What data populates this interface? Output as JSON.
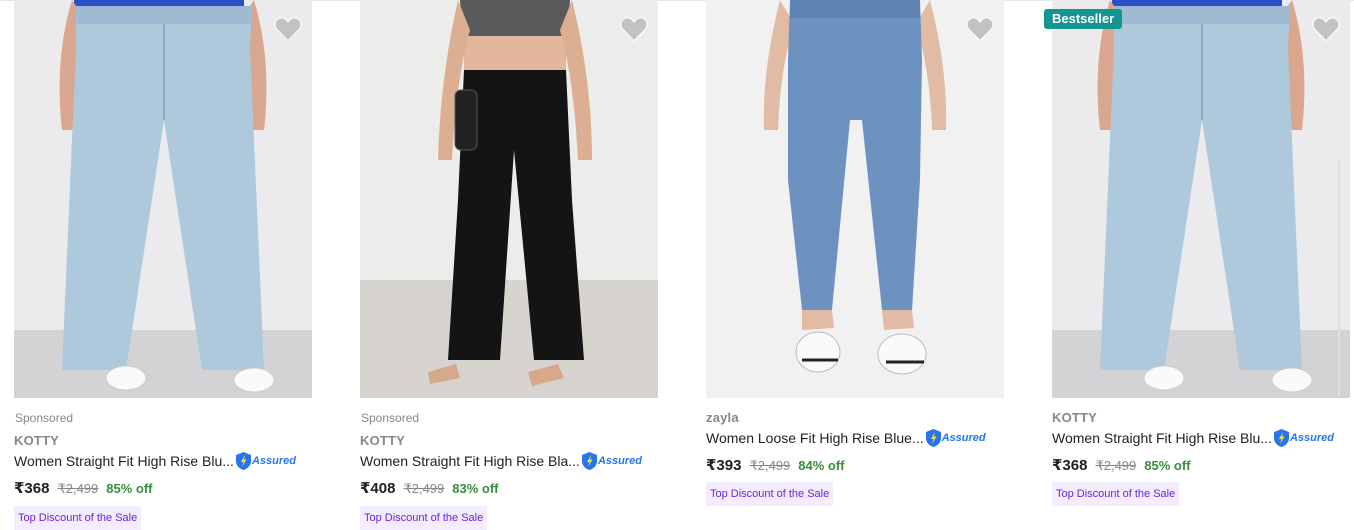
{
  "products": [
    {
      "sponsored": "Sponsored",
      "brand": "KOTTY",
      "title": "Women Straight Fit High Rise Blu...",
      "assured": "Assured",
      "price": "₹368",
      "mrp": "₹2,499",
      "discount": "85% off",
      "tag": "Top Discount of the Sale",
      "image_icon": "jeans-photo-light-blue-wide"
    },
    {
      "sponsored": "Sponsored",
      "brand": "KOTTY",
      "title": "Women Straight Fit High Rise Bla...",
      "assured": "Assured",
      "price": "₹408",
      "mrp": "₹2,499",
      "discount": "83% off",
      "tag": "Top Discount of the Sale",
      "image_icon": "jeans-photo-black-wide"
    },
    {
      "brand": "zayla",
      "title": "Women Loose Fit High Rise Blue...",
      "assured": "Assured",
      "price": "₹393",
      "mrp": "₹2,499",
      "discount": "84% off",
      "tag": "Top Discount of the Sale",
      "image_icon": "jeans-photo-mid-blue-cropped"
    },
    {
      "badge": "Bestseller",
      "brand": "KOTTY",
      "title": "Women Straight Fit High Rise Blu...",
      "assured": "Assured",
      "price": "₹368",
      "mrp": "₹2,499",
      "discount": "85% off",
      "tag": "Top Discount of the Sale",
      "image_icon": "jeans-photo-light-blue-wide"
    }
  ],
  "colors": {
    "price_green": "#388e3c",
    "tag_bg": "#f4ecff",
    "tag_text": "#6c23e0",
    "badge_bg": "#14958f",
    "assured_blue": "#2874f0"
  }
}
